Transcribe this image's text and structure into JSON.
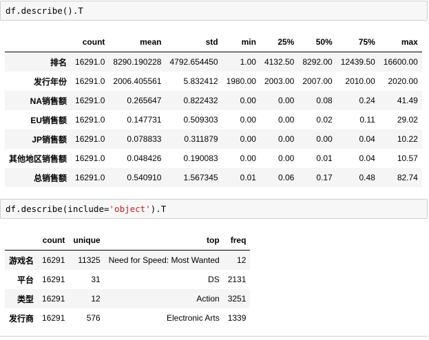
{
  "cell1": {
    "code": "df.describe().T"
  },
  "table1": {
    "columns": [
      "count",
      "mean",
      "std",
      "min",
      "25%",
      "50%",
      "75%",
      "max"
    ],
    "rows": [
      {
        "label": "排名",
        "values": [
          "16291.0",
          "8290.190228",
          "4792.654450",
          "1.00",
          "4132.50",
          "8292.00",
          "12439.50",
          "16600.00"
        ]
      },
      {
        "label": "发行年份",
        "values": [
          "16291.0",
          "2006.405561",
          "5.832412",
          "1980.00",
          "2003.00",
          "2007.00",
          "2010.00",
          "2020.00"
        ]
      },
      {
        "label": "NA销售额",
        "values": [
          "16291.0",
          "0.265647",
          "0.822432",
          "0.00",
          "0.00",
          "0.08",
          "0.24",
          "41.49"
        ]
      },
      {
        "label": "EU销售额",
        "values": [
          "16291.0",
          "0.147731",
          "0.509303",
          "0.00",
          "0.00",
          "0.02",
          "0.11",
          "29.02"
        ]
      },
      {
        "label": "JP销售额",
        "values": [
          "16291.0",
          "0.078833",
          "0.311879",
          "0.00",
          "0.00",
          "0.00",
          "0.04",
          "10.22"
        ]
      },
      {
        "label": "其他地区销售额",
        "values": [
          "16291.0",
          "0.048426",
          "0.190083",
          "0.00",
          "0.00",
          "0.01",
          "0.04",
          "10.57"
        ]
      },
      {
        "label": "总销售额",
        "values": [
          "16291.0",
          "0.540910",
          "1.567345",
          "0.01",
          "0.06",
          "0.17",
          "0.48",
          "82.74"
        ]
      }
    ]
  },
  "cell2": {
    "code_prefix": "df.describe(include=",
    "code_string": "'object'",
    "code_suffix": ").T"
  },
  "table2": {
    "columns": [
      "count",
      "unique",
      "top",
      "freq"
    ],
    "rows": [
      {
        "label": "游戏名",
        "values": [
          "16291",
          "11325",
          "Need for Speed: Most Wanted",
          "12"
        ]
      },
      {
        "label": "平台",
        "values": [
          "16291",
          "31",
          "DS",
          "2131"
        ]
      },
      {
        "label": "类型",
        "values": [
          "16291",
          "12",
          "Action",
          "3251"
        ]
      },
      {
        "label": "发行商",
        "values": [
          "16291",
          "576",
          "Electronic Arts",
          "1339"
        ]
      }
    ]
  }
}
